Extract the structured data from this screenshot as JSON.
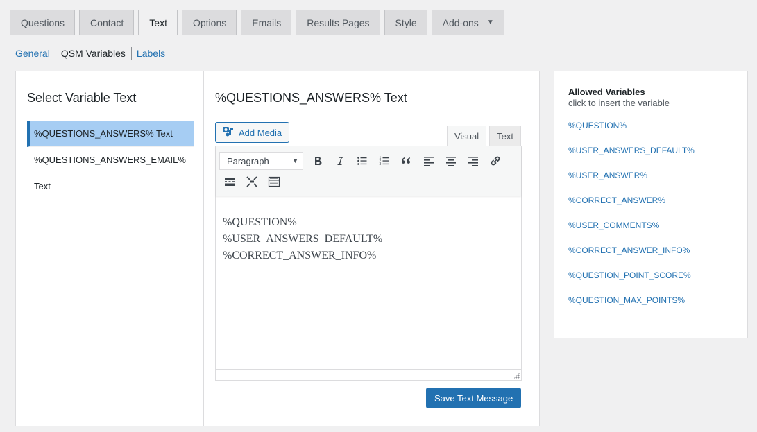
{
  "tabs": [
    {
      "label": "Questions",
      "active": false
    },
    {
      "label": "Contact",
      "active": false
    },
    {
      "label": "Text",
      "active": true
    },
    {
      "label": "Options",
      "active": false
    },
    {
      "label": "Emails",
      "active": false
    },
    {
      "label": "Results Pages",
      "active": false
    },
    {
      "label": "Style",
      "active": false
    },
    {
      "label": "Add-ons",
      "active": false,
      "dropdown": true
    }
  ],
  "subnav": {
    "items": [
      {
        "label": "General",
        "current": false
      },
      {
        "label": "QSM Variables",
        "current": true
      },
      {
        "label": "Labels",
        "current": false
      }
    ]
  },
  "left_panel": {
    "title": "Select Variable Text",
    "items": [
      {
        "label": "%QUESTIONS_ANSWERS% Text",
        "active": true
      },
      {
        "label": "%QUESTIONS_ANSWERS_EMAIL% Text",
        "active": false
      }
    ]
  },
  "editor_panel": {
    "title": "%QUESTIONS_ANSWERS% Text",
    "add_media_label": "Add Media",
    "editor_tabs": {
      "visual": "Visual",
      "text": "Text"
    },
    "format_select": "Paragraph",
    "toolbar_icons": [
      "bold-icon",
      "italic-icon",
      "bullet-list-icon",
      "numbered-list-icon",
      "blockquote-icon",
      "align-left-icon",
      "align-center-icon",
      "align-right-icon",
      "link-icon",
      "read-more-icon",
      "fullscreen-icon",
      "toolbar-toggle-icon"
    ],
    "content_lines": [
      "%QUESTION%",
      "%USER_ANSWERS_DEFAULT%",
      "%CORRECT_ANSWER_INFO%"
    ],
    "save_label": "Save Text Message"
  },
  "allowed_variables": {
    "title": "Allowed Variables",
    "hint": "click to insert the variable",
    "items": [
      "%QUESTION%",
      "%USER_ANSWERS_DEFAULT%",
      "%USER_ANSWER%",
      "%CORRECT_ANSWER%",
      "%USER_COMMENTS%",
      "%CORRECT_ANSWER_INFO%",
      "%QUESTION_POINT_SCORE%",
      "%QUESTION_MAX_POINTS%"
    ]
  },
  "colors": {
    "accent": "#2271b1",
    "active_item_bg": "#a6cdf3",
    "page_bg": "#f0f0f1"
  }
}
